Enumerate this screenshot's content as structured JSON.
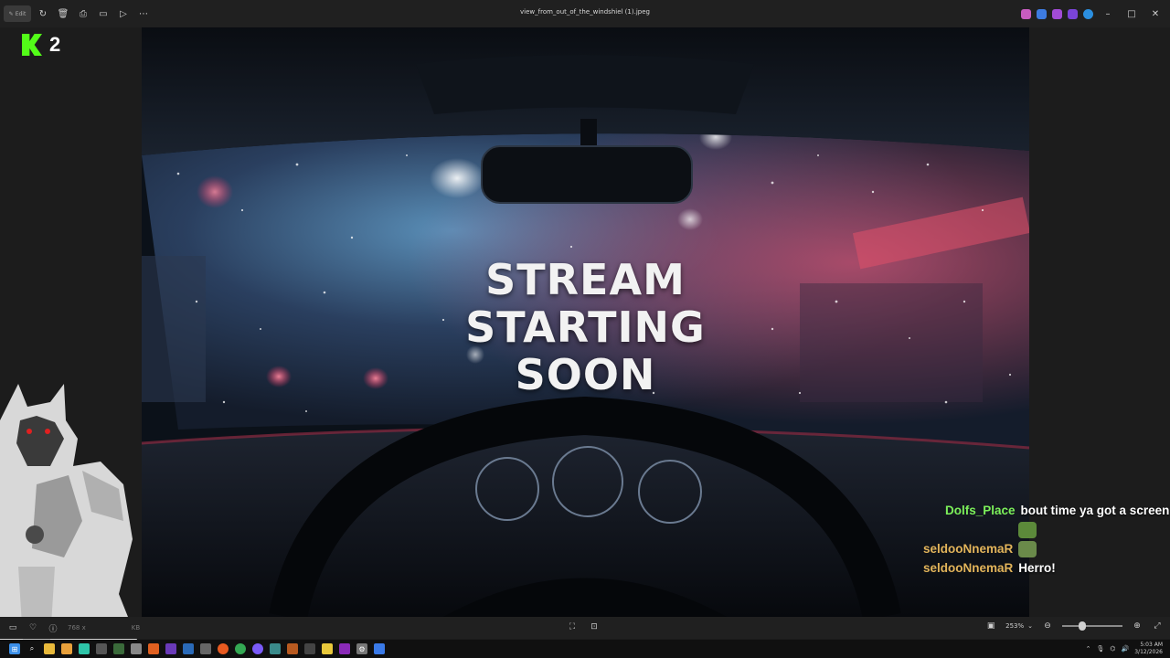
{
  "window": {
    "title": "view_from_out_of_the_windshiel (1).jpeg",
    "edit_label": "Edit",
    "toolbar_icons": [
      "rotate-icon",
      "delete-icon",
      "print-icon",
      "folder-icon",
      "slideshow-icon",
      "more-icon"
    ],
    "controls": {
      "minimize": "–",
      "maximize": "□",
      "close": "✕"
    }
  },
  "overlay": {
    "viewer_count": "2",
    "brand_color": "#53fc18"
  },
  "image": {
    "headline_lines": [
      "STREAM",
      "STARTING",
      "SOON"
    ]
  },
  "chat": {
    "messages": [
      {
        "user": "Dolfs_Place",
        "user_color": "#7cf05a",
        "text": "bout time ya got a screen",
        "emote": ""
      },
      {
        "user": "",
        "user_color": "#7cf05a",
        "text": "",
        "emote": "frog-emote"
      },
      {
        "user": "seldooNnemaR",
        "user_color": "#e2b45a",
        "text": "",
        "emote": "frog-emote"
      },
      {
        "user": "seldooNnemaR",
        "user_color": "#e2b45a",
        "text": "Herro!",
        "emote": ""
      }
    ]
  },
  "statusbar": {
    "dimensions": "768 x",
    "filesize": "KB",
    "zoom": "253%",
    "zoom_fraction": 0.33
  },
  "taskbar": {
    "time": "5:03 AM",
    "date": "3/12/2026"
  }
}
